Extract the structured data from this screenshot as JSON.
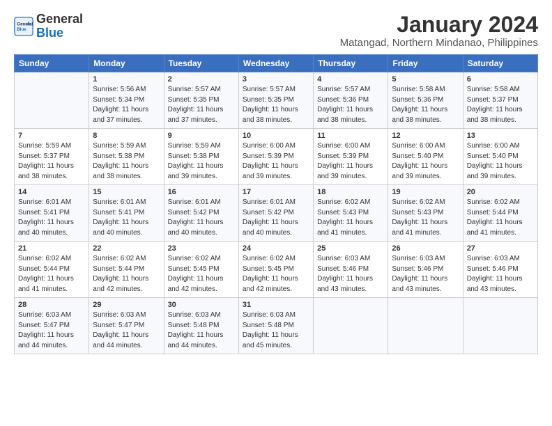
{
  "header": {
    "logo_general": "General",
    "logo_blue": "Blue",
    "title": "January 2024",
    "subtitle": "Matangad, Northern Mindanao, Philippines"
  },
  "columns": [
    "Sunday",
    "Monday",
    "Tuesday",
    "Wednesday",
    "Thursday",
    "Friday",
    "Saturday"
  ],
  "weeks": [
    [
      {
        "day": "",
        "text": ""
      },
      {
        "day": "1",
        "text": "Sunrise: 5:56 AM\nSunset: 5:34 PM\nDaylight: 11 hours\nand 37 minutes."
      },
      {
        "day": "2",
        "text": "Sunrise: 5:57 AM\nSunset: 5:35 PM\nDaylight: 11 hours\nand 37 minutes."
      },
      {
        "day": "3",
        "text": "Sunrise: 5:57 AM\nSunset: 5:35 PM\nDaylight: 11 hours\nand 38 minutes."
      },
      {
        "day": "4",
        "text": "Sunrise: 5:57 AM\nSunset: 5:36 PM\nDaylight: 11 hours\nand 38 minutes."
      },
      {
        "day": "5",
        "text": "Sunrise: 5:58 AM\nSunset: 5:36 PM\nDaylight: 11 hours\nand 38 minutes."
      },
      {
        "day": "6",
        "text": "Sunrise: 5:58 AM\nSunset: 5:37 PM\nDaylight: 11 hours\nand 38 minutes."
      }
    ],
    [
      {
        "day": "7",
        "text": "Sunrise: 5:59 AM\nSunset: 5:37 PM\nDaylight: 11 hours\nand 38 minutes."
      },
      {
        "day": "8",
        "text": "Sunrise: 5:59 AM\nSunset: 5:38 PM\nDaylight: 11 hours\nand 38 minutes."
      },
      {
        "day": "9",
        "text": "Sunrise: 5:59 AM\nSunset: 5:38 PM\nDaylight: 11 hours\nand 39 minutes."
      },
      {
        "day": "10",
        "text": "Sunrise: 6:00 AM\nSunset: 5:39 PM\nDaylight: 11 hours\nand 39 minutes."
      },
      {
        "day": "11",
        "text": "Sunrise: 6:00 AM\nSunset: 5:39 PM\nDaylight: 11 hours\nand 39 minutes."
      },
      {
        "day": "12",
        "text": "Sunrise: 6:00 AM\nSunset: 5:40 PM\nDaylight: 11 hours\nand 39 minutes."
      },
      {
        "day": "13",
        "text": "Sunrise: 6:00 AM\nSunset: 5:40 PM\nDaylight: 11 hours\nand 39 minutes."
      }
    ],
    [
      {
        "day": "14",
        "text": "Sunrise: 6:01 AM\nSunset: 5:41 PM\nDaylight: 11 hours\nand 40 minutes."
      },
      {
        "day": "15",
        "text": "Sunrise: 6:01 AM\nSunset: 5:41 PM\nDaylight: 11 hours\nand 40 minutes."
      },
      {
        "day": "16",
        "text": "Sunrise: 6:01 AM\nSunset: 5:42 PM\nDaylight: 11 hours\nand 40 minutes."
      },
      {
        "day": "17",
        "text": "Sunrise: 6:01 AM\nSunset: 5:42 PM\nDaylight: 11 hours\nand 40 minutes."
      },
      {
        "day": "18",
        "text": "Sunrise: 6:02 AM\nSunset: 5:43 PM\nDaylight: 11 hours\nand 41 minutes."
      },
      {
        "day": "19",
        "text": "Sunrise: 6:02 AM\nSunset: 5:43 PM\nDaylight: 11 hours\nand 41 minutes."
      },
      {
        "day": "20",
        "text": "Sunrise: 6:02 AM\nSunset: 5:44 PM\nDaylight: 11 hours\nand 41 minutes."
      }
    ],
    [
      {
        "day": "21",
        "text": "Sunrise: 6:02 AM\nSunset: 5:44 PM\nDaylight: 11 hours\nand 41 minutes."
      },
      {
        "day": "22",
        "text": "Sunrise: 6:02 AM\nSunset: 5:44 PM\nDaylight: 11 hours\nand 42 minutes."
      },
      {
        "day": "23",
        "text": "Sunrise: 6:02 AM\nSunset: 5:45 PM\nDaylight: 11 hours\nand 42 minutes."
      },
      {
        "day": "24",
        "text": "Sunrise: 6:02 AM\nSunset: 5:45 PM\nDaylight: 11 hours\nand 42 minutes."
      },
      {
        "day": "25",
        "text": "Sunrise: 6:03 AM\nSunset: 5:46 PM\nDaylight: 11 hours\nand 43 minutes."
      },
      {
        "day": "26",
        "text": "Sunrise: 6:03 AM\nSunset: 5:46 PM\nDaylight: 11 hours\nand 43 minutes."
      },
      {
        "day": "27",
        "text": "Sunrise: 6:03 AM\nSunset: 5:46 PM\nDaylight: 11 hours\nand 43 minutes."
      }
    ],
    [
      {
        "day": "28",
        "text": "Sunrise: 6:03 AM\nSunset: 5:47 PM\nDaylight: 11 hours\nand 44 minutes."
      },
      {
        "day": "29",
        "text": "Sunrise: 6:03 AM\nSunset: 5:47 PM\nDaylight: 11 hours\nand 44 minutes."
      },
      {
        "day": "30",
        "text": "Sunrise: 6:03 AM\nSunset: 5:48 PM\nDaylight: 11 hours\nand 44 minutes."
      },
      {
        "day": "31",
        "text": "Sunrise: 6:03 AM\nSunset: 5:48 PM\nDaylight: 11 hours\nand 45 minutes."
      },
      {
        "day": "",
        "text": ""
      },
      {
        "day": "",
        "text": ""
      },
      {
        "day": "",
        "text": ""
      }
    ]
  ]
}
